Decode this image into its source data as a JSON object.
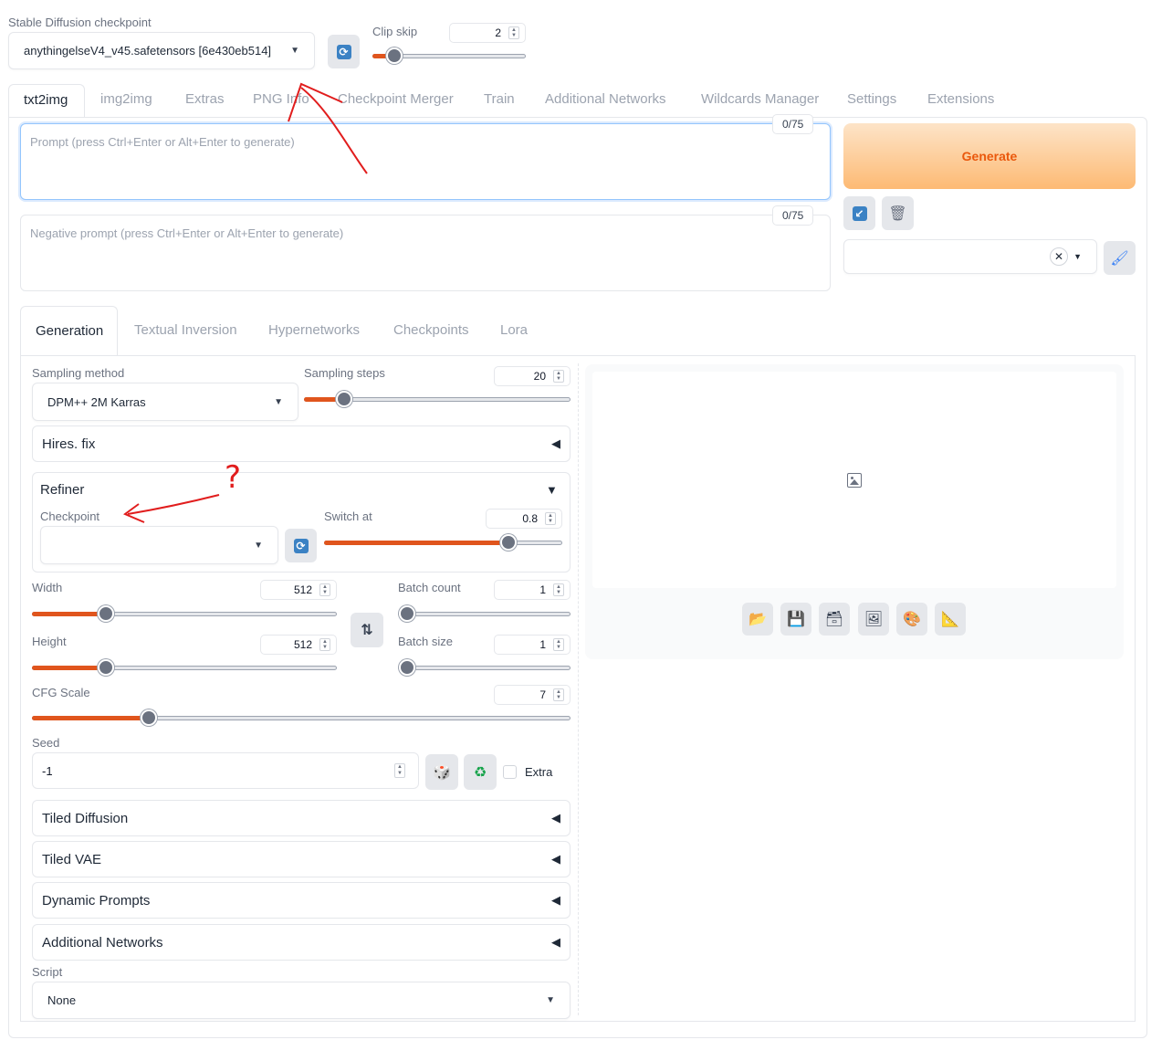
{
  "checkpoint": {
    "label": "Stable Diffusion checkpoint",
    "value": "anythingelseV4_v45.safetensors [6e430eb514]"
  },
  "clip_skip": {
    "label": "Clip skip",
    "value": "2",
    "fraction": 0.1
  },
  "main_tabs": [
    "txt2img",
    "img2img",
    "Extras",
    "PNG Info",
    "Checkpoint Merger",
    "Train",
    "Additional Networks",
    "Wildcards Manager",
    "Settings",
    "Extensions"
  ],
  "prompt": {
    "placeholder": "Prompt (press Ctrl+Enter or Alt+Enter to generate)",
    "counter": "0/75"
  },
  "negative_prompt": {
    "placeholder": "Negative prompt (press Ctrl+Enter or Alt+Enter to generate)",
    "counter": "0/75"
  },
  "generate_label": "Generate",
  "sub_tabs": [
    "Generation",
    "Textual Inversion",
    "Hypernetworks",
    "Checkpoints",
    "Lora"
  ],
  "sampling": {
    "method_label": "Sampling method",
    "method_value": "DPM++ 2M Karras",
    "steps_label": "Sampling steps",
    "steps_value": "20"
  },
  "hires_label": "Hires. fix",
  "refiner": {
    "title": "Refiner",
    "checkpoint_label": "Checkpoint",
    "checkpoint_value": "",
    "switch_label": "Switch at",
    "switch_value": "0.8"
  },
  "width": {
    "label": "Width",
    "value": "512"
  },
  "height": {
    "label": "Height",
    "value": "512"
  },
  "batch_count": {
    "label": "Batch count",
    "value": "1"
  },
  "batch_size": {
    "label": "Batch size",
    "value": "1"
  },
  "cfg": {
    "label": "CFG Scale",
    "value": "7"
  },
  "seed": {
    "label": "Seed",
    "value": "-1",
    "extra_label": "Extra"
  },
  "accordions": [
    "Tiled Diffusion",
    "Tiled VAE",
    "Dynamic Prompts",
    "Additional Networks"
  ],
  "script": {
    "label": "Script",
    "value": "None"
  },
  "annotations": {
    "question_mark": "?"
  },
  "colors": {
    "accent": "#e0551d",
    "generate_bg": "#fdba74",
    "generate_text": "#ea580c"
  }
}
